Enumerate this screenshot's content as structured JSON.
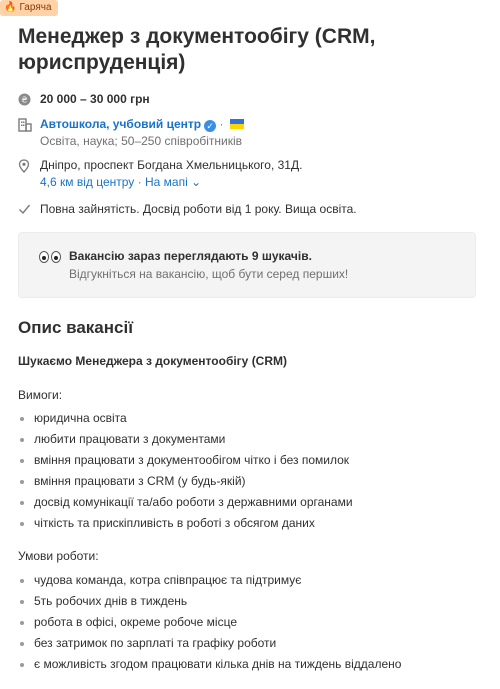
{
  "badge": {
    "label": "Гаряча",
    "icon": "fire-icon"
  },
  "job": {
    "title": "Менеджер з документообігу (CRM, юриспруденція)",
    "salary": "20 000 – 30 000 грн"
  },
  "company": {
    "name": "Автошкола, учбовий центр",
    "meta": "Освіта, наука; 50–250 співробітників",
    "separator": "·"
  },
  "location": {
    "address": "Дніпро, проспект Богдана Хмельницького, 31Д.",
    "distance": "4,6 км від центру",
    "map_label": "На мапі"
  },
  "conditions_summary": "Повна зайнятість. Досвід роботи від 1 року. Вища освіта.",
  "viewers": {
    "line1": "Вакансію зараз переглядають 9 шукачів.",
    "line2": "Відгукніться на вакансію, щоб бути серед перших!"
  },
  "description": {
    "title": "Опис вакансії",
    "lookfor": "Шукаємо Менеджера з документообігу (CRM)",
    "requirements_title": "Вимоги:",
    "requirements": [
      "юридична освіта",
      "любити працювати з документами",
      "вміння працювати з документообігом чітко і без помилок",
      "вміння працювати з CRM (у будь-якій)",
      "досвід комунікації та/або роботи з державними органами",
      "чіткість та прискіпливість в роботі з обсягом даних"
    ],
    "conditions_title": "Умови роботи:",
    "conditions": [
      "чудова команда, котра співпрацює та підтримує",
      "5ть робочих днів в тиждень",
      "робота в офісі, окреме робоче місце",
      "без затримок по зарплаті та графіку роботи",
      "є можливість згодом працювати кілька днів на тиждень віддалено"
    ]
  },
  "colors": {
    "link": "#1a73c9",
    "badge_bg": "#ffd2a8",
    "text": "#303030",
    "muted": "#707070"
  }
}
